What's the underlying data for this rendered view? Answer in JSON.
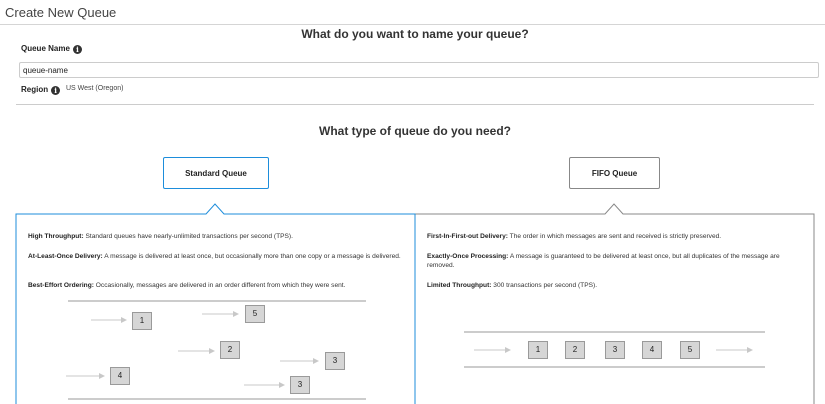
{
  "page": {
    "title": "Create New Queue"
  },
  "name_section": {
    "heading": "What do you want to name your queue?",
    "queue_name_label": "Queue Name",
    "queue_name_value": "queue-name",
    "region_label": "Region",
    "region_value": "US West (Oregon)"
  },
  "type_section": {
    "heading": "What type of queue do you need?",
    "standard_label": "Standard Queue",
    "fifo_label": "FIFO Queue",
    "selected": "Standard Queue"
  },
  "standard": {
    "features": [
      {
        "title": "High Throughput:",
        "text": " Standard queues have nearly-unlimited transactions per second (TPS)."
      },
      {
        "title": "At-Least-Once Delivery:",
        "text": " A message is delivered at least once, but occasionally more than one copy or a message is delivered."
      },
      {
        "title": "Best-Effort Ordering:",
        "text": " Occasionally, messages are delivered in an order different from which they were sent."
      }
    ],
    "diagram_boxes": [
      "1",
      "5",
      "2",
      "3",
      "4",
      "3"
    ]
  },
  "fifo": {
    "features": [
      {
        "title": "First-In-First-out Delivery:",
        "text": " The order in which messages are sent and received is strictly preserved."
      },
      {
        "title": "Exactly-Once Processing:",
        "text": " A message is guaranteed to be delivered at least once, but all duplicates of the message are removed."
      },
      {
        "title": "Limited Throughput:",
        "text": " 300 transactions per second (TPS)."
      }
    ],
    "diagram_boxes": [
      "1",
      "2",
      "3",
      "4",
      "5"
    ]
  },
  "colors": {
    "selected_border": "#1d8ddb",
    "unselected_border": "#888888",
    "box_fill": "#d6d6d6"
  },
  "icons": {
    "info": "info-circle-icon",
    "arrow": "right-arrow-icon"
  }
}
